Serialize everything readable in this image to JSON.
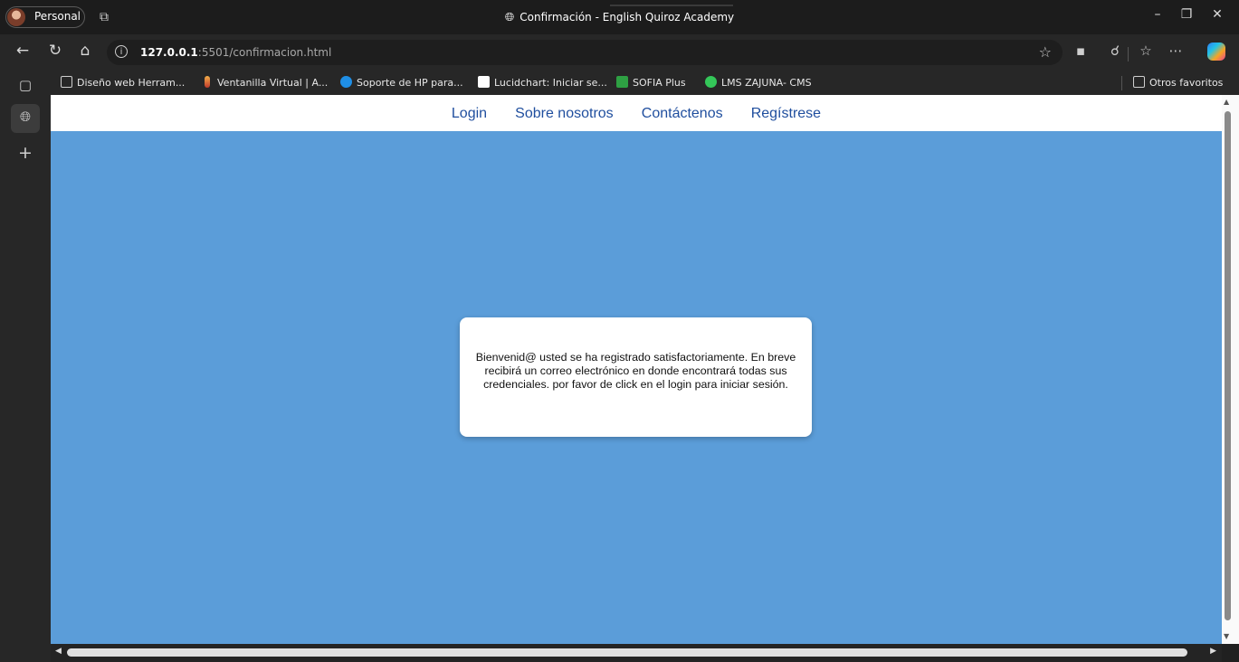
{
  "browser": {
    "profile_label": "Personal",
    "window_title": "Confirmación - English Quiroz Academy",
    "url_host": "127.0.0.1",
    "url_rest": ":5501/confirmacion.html"
  },
  "bookmarks": [
    {
      "label": "Diseño web Herram...",
      "icon": "folder-icon"
    },
    {
      "label": "Ventanilla Virtual | A...",
      "icon": "pin-icon"
    },
    {
      "label": "Soporte de HP para...",
      "icon": "hp-icon"
    },
    {
      "label": "Lucidchart: Iniciar se...",
      "icon": "lucidchart-icon"
    },
    {
      "label": "SOFIA Plus",
      "icon": "sofia-icon"
    },
    {
      "label": "LMS ZAJUNA- CMS",
      "icon": "lms-icon"
    }
  ],
  "other_favorites": "Otros favoritos",
  "site": {
    "nav": [
      "Login",
      "Sobre nosotros",
      "Contáctenos",
      "Regístrese"
    ],
    "message": "Bienvenid@ usted se ha registrado satisfactoriamente. En breve recibirá un correo electrónico en donde encontrará todas sus credenciales. por favor de click en el login para iniciar sesión."
  },
  "colors": {
    "page_background": "#5b9dd9",
    "nav_link": "#1f4e9e",
    "card": "#ffffff"
  }
}
